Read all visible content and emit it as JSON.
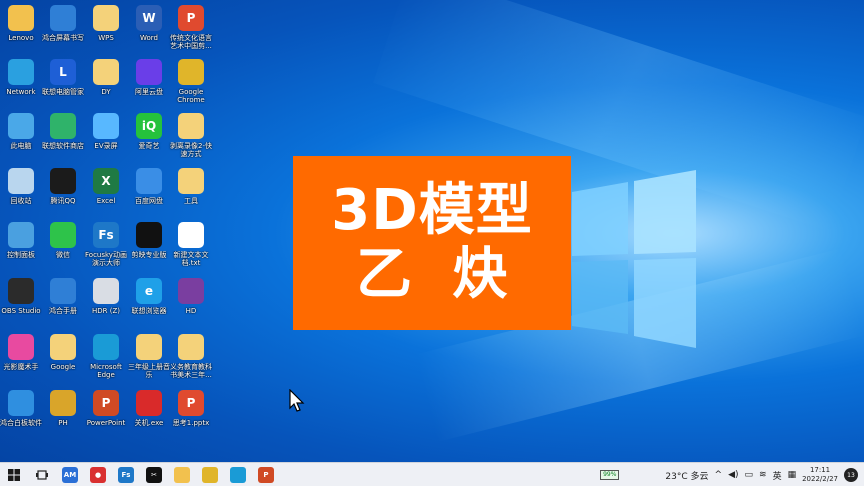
{
  "desktop": {
    "icons": [
      {
        "label": "Lenovo",
        "icon": "folder-user-icon",
        "glyph": "",
        "color": "#f2c14e",
        "col": 0,
        "row": 0
      },
      {
        "label": "鸿合屏幕书写",
        "icon": "screen-writer-icon",
        "glyph": "",
        "color": "#2f7fd6",
        "col": 1,
        "row": 0
      },
      {
        "label": "WPS",
        "icon": "folder-icon",
        "glyph": "",
        "color": "#f4d27a",
        "col": 2,
        "row": 0
      },
      {
        "label": "Word",
        "icon": "word-icon",
        "glyph": "W",
        "color": "#2b5eb5",
        "col": 3,
        "row": 0
      },
      {
        "label": "传统文化语言艺术中国剪...",
        "icon": "ppt-file-icon",
        "glyph": "P",
        "color": "#e04a2f",
        "col": 4,
        "row": 0
      },
      {
        "label": "Network",
        "icon": "network-icon",
        "glyph": "",
        "color": "#2aa0e0",
        "col": 0,
        "row": 1
      },
      {
        "label": "联想电脑管家",
        "icon": "lenovo-manager-icon",
        "glyph": "L",
        "color": "#1e5fd6",
        "col": 1,
        "row": 1
      },
      {
        "label": "DY",
        "icon": "folder-icon",
        "glyph": "",
        "color": "#f4d27a",
        "col": 2,
        "row": 1
      },
      {
        "label": "阿里云盘",
        "icon": "aliyun-drive-icon",
        "glyph": "",
        "color": "#6a3ee8",
        "col": 3,
        "row": 1
      },
      {
        "label": "Google Chrome",
        "icon": "chrome-icon",
        "glyph": "",
        "color": "#e0b52a",
        "col": 4,
        "row": 1
      },
      {
        "label": "此电脑",
        "icon": "this-pc-icon",
        "glyph": "",
        "color": "#4aa8e8",
        "col": 0,
        "row": 2
      },
      {
        "label": "联想软件商店",
        "icon": "lenovo-store-icon",
        "glyph": "",
        "color": "#2fb36a",
        "col": 1,
        "row": 2
      },
      {
        "label": "EV录屏",
        "icon": "ev-recorder-icon",
        "glyph": "",
        "color": "#58b8ff",
        "col": 2,
        "row": 2
      },
      {
        "label": "爱奇艺",
        "icon": "iqiyi-icon",
        "glyph": "iQ",
        "color": "#25c23c",
        "col": 3,
        "row": 2
      },
      {
        "label": "剥离录像2-快速方式",
        "icon": "folder-icon",
        "glyph": "",
        "color": "#f4d27a",
        "col": 4,
        "row": 2
      },
      {
        "label": "回收站",
        "icon": "recycle-bin-icon",
        "glyph": "",
        "color": "#b9d6ee",
        "col": 0,
        "row": 3
      },
      {
        "label": "腾讯QQ",
        "icon": "qq-icon",
        "glyph": "",
        "color": "#1b1b1b",
        "col": 1,
        "row": 3
      },
      {
        "label": "Excel",
        "icon": "excel-icon",
        "glyph": "X",
        "color": "#1f7a44",
        "col": 2,
        "row": 3
      },
      {
        "label": "百度网盘",
        "icon": "baidu-netdisk-icon",
        "glyph": "",
        "color": "#3a8ee6",
        "col": 3,
        "row": 3
      },
      {
        "label": "工具",
        "icon": "folder-icon",
        "glyph": "",
        "color": "#f4d27a",
        "col": 4,
        "row": 3
      },
      {
        "label": "控制面板",
        "icon": "control-panel-icon",
        "glyph": "",
        "color": "#4aa0e0",
        "col": 0,
        "row": 4
      },
      {
        "label": "微信",
        "icon": "wechat-icon",
        "glyph": "",
        "color": "#2ec34a",
        "col": 1,
        "row": 4
      },
      {
        "label": "Focusky动画演示大师",
        "icon": "focusky-icon",
        "glyph": "Fs",
        "color": "#1e78c8",
        "col": 2,
        "row": 4
      },
      {
        "label": "剪映专业版",
        "icon": "capcut-icon",
        "glyph": "",
        "color": "#111111",
        "col": 3,
        "row": 4
      },
      {
        "label": "新建文本文档.txt",
        "icon": "text-file-icon",
        "glyph": "",
        "color": "#ffffff",
        "col": 4,
        "row": 4
      },
      {
        "label": "OBS Studio",
        "icon": "obs-icon",
        "glyph": "",
        "color": "#2b2b2b",
        "col": 0,
        "row": 5
      },
      {
        "label": "鸿合手册",
        "icon": "manual-icon",
        "glyph": "",
        "color": "#2f7fd6",
        "col": 1,
        "row": 5
      },
      {
        "label": "HDR (Z)",
        "icon": "drive-icon",
        "glyph": "",
        "color": "#d9dde4",
        "col": 2,
        "row": 5
      },
      {
        "label": "联想浏览器",
        "icon": "lenovo-browser-icon",
        "glyph": "e",
        "color": "#1fa0e8",
        "col": 3,
        "row": 5
      },
      {
        "label": "HD",
        "icon": "hd-icon",
        "glyph": "",
        "color": "#7a3ea0",
        "col": 4,
        "row": 5
      },
      {
        "label": "光影魔术手",
        "icon": "nevercolor-icon",
        "glyph": "",
        "color": "#e84aa0",
        "col": 0,
        "row": 6
      },
      {
        "label": "Google",
        "icon": "folder-icon",
        "glyph": "",
        "color": "#f4d27a",
        "col": 1,
        "row": 6
      },
      {
        "label": "Microsoft Edge",
        "icon": "edge-icon",
        "glyph": "",
        "color": "#1a9bd6",
        "col": 2,
        "row": 6
      },
      {
        "label": "三年级上册音乐",
        "icon": "folder-icon",
        "glyph": "",
        "color": "#f4d27a",
        "col": 3,
        "row": 6
      },
      {
        "label": "义务教育教科书美术三年...",
        "icon": "folder-icon",
        "glyph": "",
        "color": "#f4d27a",
        "col": 4,
        "row": 6
      },
      {
        "label": "鸿合白板软件",
        "icon": "whiteboard-icon",
        "glyph": "",
        "color": "#2f8fe0",
        "col": 0,
        "row": 7
      },
      {
        "label": "PH",
        "icon": "ph-icon",
        "glyph": "",
        "color": "#d9a52a",
        "col": 1,
        "row": 7
      },
      {
        "label": "PowerPoint",
        "icon": "powerpoint-icon",
        "glyph": "P",
        "color": "#d04a24",
        "col": 2,
        "row": 7
      },
      {
        "label": "关机.exe",
        "icon": "shutdown-icon",
        "glyph": "",
        "color": "#d92a2a",
        "col": 3,
        "row": 7
      },
      {
        "label": "思考1.pptx",
        "icon": "ppt-file-icon",
        "glyph": "P",
        "color": "#e04a2f",
        "col": 4,
        "row": 7
      }
    ]
  },
  "banner": {
    "line1": "3D模型",
    "line2": "乙炔",
    "bg": "#ff6a00"
  },
  "taskbar": {
    "start_icon": "windows-start-icon",
    "taskview_icon": "task-view-icon",
    "apps": [
      {
        "icon": "am-app-icon",
        "glyph": "AM",
        "color": "#2a6fd6"
      },
      {
        "icon": "recorder-app-icon",
        "glyph": "●",
        "color": "#d93030"
      },
      {
        "icon": "focusky-app-icon",
        "glyph": "Fs",
        "color": "#1e78c8"
      },
      {
        "icon": "capcut-app-icon",
        "glyph": "✂",
        "color": "#111111"
      },
      {
        "icon": "file-explorer-icon",
        "glyph": "",
        "color": "#f2c14e"
      },
      {
        "icon": "chrome-app-icon",
        "glyph": "",
        "color": "#e0b52a"
      },
      {
        "icon": "edge-app-icon",
        "glyph": "",
        "color": "#1a9bd6"
      },
      {
        "icon": "powerpoint-app-icon",
        "glyph": "P",
        "color": "#d04a24"
      }
    ],
    "battery": "99%",
    "weather": "23°C 多云",
    "ime": "英",
    "time": "17:11",
    "date": "2022/2/27",
    "notifications": "13"
  }
}
